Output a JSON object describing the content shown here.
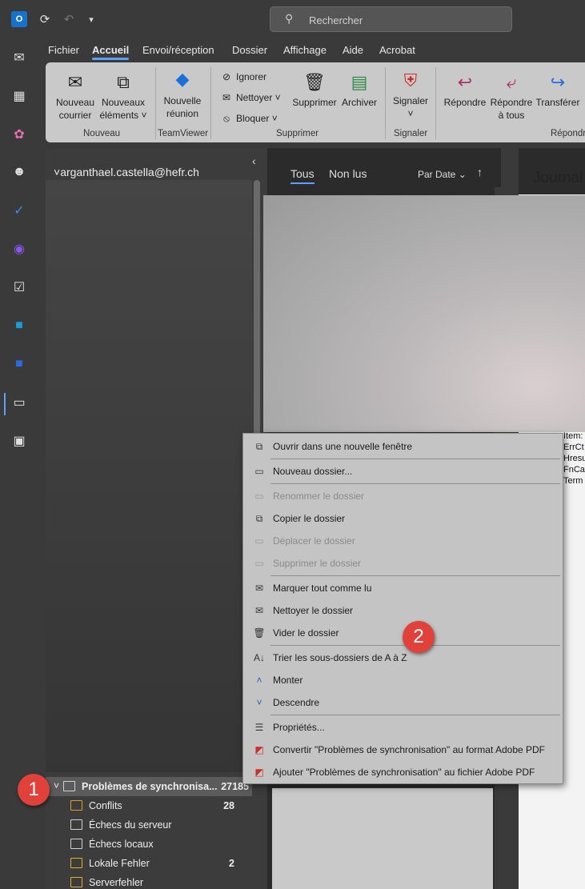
{
  "titlebar": {
    "search_placeholder": "Rechercher"
  },
  "menu_tabs": [
    "Fichier",
    "Accueil",
    "Envoi/réception",
    "Dossier",
    "Affichage",
    "Aide",
    "Acrobat"
  ],
  "ribbon": {
    "new_mail": [
      "Nouveau",
      "courrier"
    ],
    "new_items": [
      "Nouveaux",
      "éléments ˅"
    ],
    "new_group": "Nouveau",
    "new_meeting": [
      "Nouvelle",
      "réunion"
    ],
    "teamviewer_group": "TeamViewer",
    "ignore": "Ignorer",
    "clean": "Nettoyer ˅",
    "block": "Bloquer ˅",
    "delete": "Supprimer",
    "archive": "Archiver",
    "delete_group": "Supprimer",
    "report": [
      "Signaler",
      "˅"
    ],
    "report_group": "Signaler",
    "reply": "Répondre",
    "reply_all": [
      "Répondre",
      "à tous"
    ],
    "forward": "Transférer",
    "respond_group": "Répondr"
  },
  "folder_pane": {
    "account": "arganthael.castella@hefr.ch",
    "folders": [
      {
        "label": "Problèmes de synchronisa...",
        "count": "27185"
      },
      {
        "label": "Conflits",
        "count": "28"
      },
      {
        "label": "Échecs du serveur",
        "count": ""
      },
      {
        "label": "Échecs locaux",
        "count": ""
      },
      {
        "label": "Lokale Fehler",
        "count": "2"
      },
      {
        "label": "Serverfehler",
        "count": ""
      }
    ]
  },
  "message_list": {
    "tab_all": "Tous",
    "tab_unread": "Non lus",
    "sort": "Par Date ⌄",
    "sort_dir": "↑"
  },
  "reading_pane": {
    "title": "Journal",
    "lines": [
      "Item:",
      "ErrCt",
      "Hresu",
      "FnCa",
      " Term"
    ]
  },
  "context_menu": {
    "items": [
      "Ouvrir dans une nouvelle fenêtre",
      "Nouveau dossier...",
      "Renommer le dossier",
      "Copier le dossier",
      "Déplacer le dossier",
      "Supprimer le dossier",
      "Marquer tout comme lu",
      "Nettoyer le dossier",
      "Vider le dossier",
      "Trier les sous-dossiers de A à Z",
      "Monter",
      "Descendre",
      "Propriétés...",
      "Convertir \"Problèmes de synchronisation\" au format Adobe PDF",
      "Ajouter \"Problèmes de synchronisation\" au fichier Adobe PDF"
    ]
  },
  "markers": [
    "1",
    "2"
  ],
  "colors": {
    "accent": "#5aa0ff",
    "marker": "#e0413a"
  }
}
